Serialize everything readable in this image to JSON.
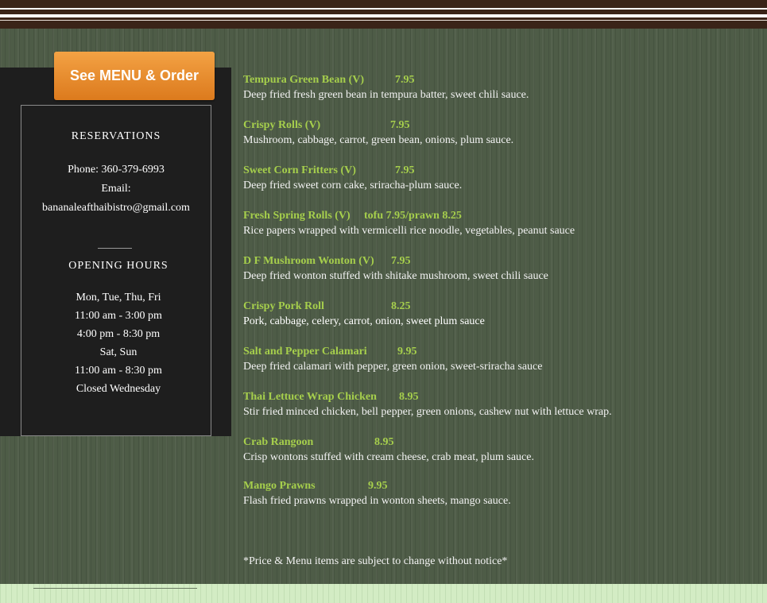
{
  "order_button": {
    "label": "See MENU & Order"
  },
  "sidebar": {
    "reservations_heading": "RESERVATIONS",
    "phone": "Phone: 360-379-6993",
    "email_label": "Email:",
    "email": "bananaleafthaibistro@gmail.com",
    "hours_heading": "OPENING HOURS",
    "hours": [
      "Mon, Tue, Thu, Fri",
      "11:00 am - 3:00 pm",
      "4:00 pm - 8:30 pm",
      "Sat, Sun",
      "11:00 am - 8:30 pm",
      "Closed Wednesday"
    ]
  },
  "menu": {
    "items": [
      {
        "name": "Tempura Green Bean (V)",
        "price": "7.95",
        "description": "Deep fried fresh green bean in tempura batter, sweet chili sauce."
      },
      {
        "name": "Crispy Rolls  (V)",
        "price": "7.95",
        "description": "Mushroom, cabbage, carrot, green bean, onions, plum sauce."
      },
      {
        "name": "Sweet Corn Fritters (V)",
        "price": "7.95",
        "description": "Deep fried sweet corn cake, sriracha-plum sauce."
      },
      {
        "name": "Fresh Spring Rolls (V)",
        "price": "tofu 7.95/prawn 8.25",
        "description": "Rice papers wrapped with vermicelli rice noodle, vegetables, peanut sauce"
      },
      {
        "name": "D F Mushroom Wonton (V)",
        "price": "7.95",
        "description": "Deep fried wonton stuffed with shitake mushroom, sweet chili sauce"
      },
      {
        "name": "Crispy Pork Roll",
        "price": "8.25",
        "description": "Pork, cabbage, celery, carrot, onion, sweet plum sauce"
      },
      {
        "name": "Salt and Pepper Calamari",
        "price": "9.95",
        "description": "Deep fried calamari with pepper, green onion, sweet-sriracha sauce"
      },
      {
        "name": "Thai Lettuce Wrap Chicken",
        "price": "8.95",
        "description": "Stir fried minced chicken, bell pepper, green onions, cashew nut with lettuce wrap."
      },
      {
        "name": "Crab Rangoon",
        "price": "8.95",
        "description": "Crisp wontons stuffed with cream cheese, crab meat, plum sauce."
      },
      {
        "name": "Mango Prawns",
        "price": "9.95",
        "description": "Flash fried prawns wrapped in wonton sheets,  mango sauce."
      }
    ],
    "disclaimer": "*Price & Menu items are subject to change without notice*"
  },
  "colors": {
    "item_name": "#a6cf4c",
    "button": "#e88a2a",
    "sidebar_bg": "#1e1e1e",
    "header": "#3a2418"
  }
}
